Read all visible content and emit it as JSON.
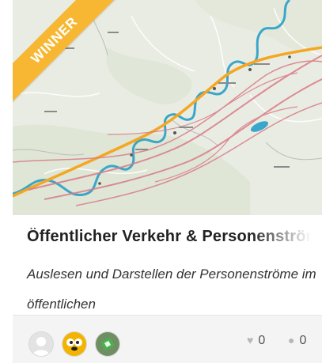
{
  "card": {
    "badge": "WINNER",
    "title": "Öffentlicher Verkehr & Personenströme",
    "description": "Auslesen und Darstellen der Personenströme im öffentlichen",
    "likes": "0",
    "comments": "0"
  },
  "icons": {
    "like": "heart-icon",
    "comment": "comment-bubble-icon"
  },
  "colors": {
    "badge": "#f7b733",
    "map_land": "#e8ebe0",
    "river": "#3aa6c9",
    "highway": "#f5a623",
    "rail": "#d97b86"
  }
}
